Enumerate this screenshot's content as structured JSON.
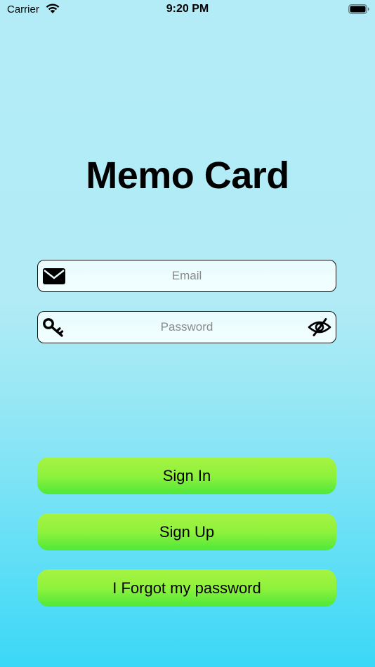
{
  "status_bar": {
    "carrier": "Carrier",
    "time": "9:20 PM"
  },
  "app": {
    "title": "Memo Card"
  },
  "form": {
    "email": {
      "placeholder": "Email",
      "value": "",
      "icon": "envelope-icon"
    },
    "password": {
      "placeholder": "Password",
      "value": "",
      "icon": "key-icon",
      "toggle_icon": "eye-slash-icon"
    }
  },
  "buttons": {
    "sign_in": "Sign In",
    "sign_up": "Sign Up",
    "forgot": "I Forgot my password"
  },
  "colors": {
    "background_top": "#b3ecf6",
    "background_bottom": "#3ad8f7",
    "button_top": "#a6f342",
    "button_bottom": "#4fe83a",
    "field_fill": "#effdfe"
  }
}
